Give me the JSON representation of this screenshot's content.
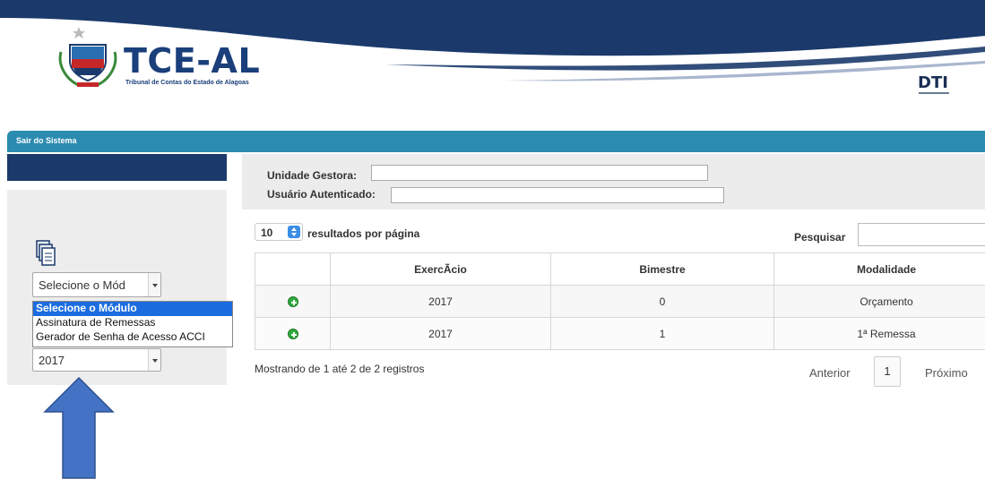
{
  "header": {
    "logo_title": "TCE-AL",
    "logo_subtitle": "Tribunal de Contas do Estado de Alagoas",
    "partner_logo": "DTI",
    "wave_color": "#1b3a6b"
  },
  "navbar": {
    "logout_label": "Sair do Sistema",
    "color": "#2b8bb0"
  },
  "sidebar": {
    "module_select_value": "Selecione o Mód",
    "dropdown_options": [
      "Selecione o Módulo",
      "Assinatura de Remessas",
      "Gerador de Senha de Acesso ACCI"
    ],
    "year_select_value": "2017",
    "icon": "documents-icon"
  },
  "info": {
    "unidade_label": "Unidade Gestora:",
    "unidade_value": "",
    "usuario_label": "Usuário Autenticado:",
    "usuario_value": ""
  },
  "table_controls": {
    "page_length": "10",
    "page_length_label": "resultados por página",
    "search_label": "Pesquisar",
    "search_value": ""
  },
  "table": {
    "columns": [
      "",
      "ExercÃcio",
      "Bimestre",
      "Modalidade"
    ],
    "rows": [
      {
        "exercicio": "2017",
        "bimestre": "0",
        "modalidade": "Orçamento"
      },
      {
        "exercicio": "2017",
        "bimestre": "1",
        "modalidade": "1ª Remessa"
      }
    ]
  },
  "footer": {
    "info": "Mostrando de 1 até 2 de 2 registros",
    "prev_label": "Anterior",
    "current_page": "1",
    "next_label": "Próximo"
  },
  "annotation": {
    "arrow_color": "#4472c4",
    "icon": "arrow-up-icon"
  }
}
